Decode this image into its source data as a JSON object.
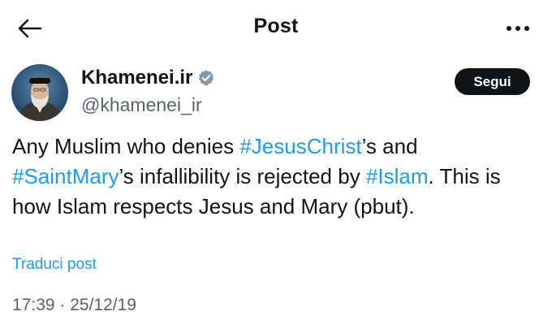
{
  "header": {
    "title": "Post",
    "back_icon": "arrow-left-icon",
    "more_icon": "more-horizontal-icon"
  },
  "author": {
    "display_name": "Khamenei.ir",
    "handle": "@khamenei_ir",
    "verified_icon": "verified-badge-icon",
    "verified_color": "#829aab",
    "follow_label": "Segui"
  },
  "tweet": {
    "segments": [
      {
        "text": "Any Muslim who denies ",
        "type": "text"
      },
      {
        "text": "#JesusChrist",
        "type": "hashtag"
      },
      {
        "text": "’s and ",
        "type": "text"
      },
      {
        "text": "#SaintMary",
        "type": "hashtag"
      },
      {
        "text": "’s infallibility is rejected by ",
        "type": "text"
      },
      {
        "text": "#Islam",
        "type": "hashtag"
      },
      {
        "text": ". This is how Islam respects Jesus and Mary (pbut).",
        "type": "text"
      }
    ],
    "translate_label": "Traduci post",
    "timestamp": "17:39 · 25/12/19"
  },
  "colors": {
    "accent": "#1d9bf0",
    "text": "#0f1419",
    "secondary": "#536471"
  }
}
